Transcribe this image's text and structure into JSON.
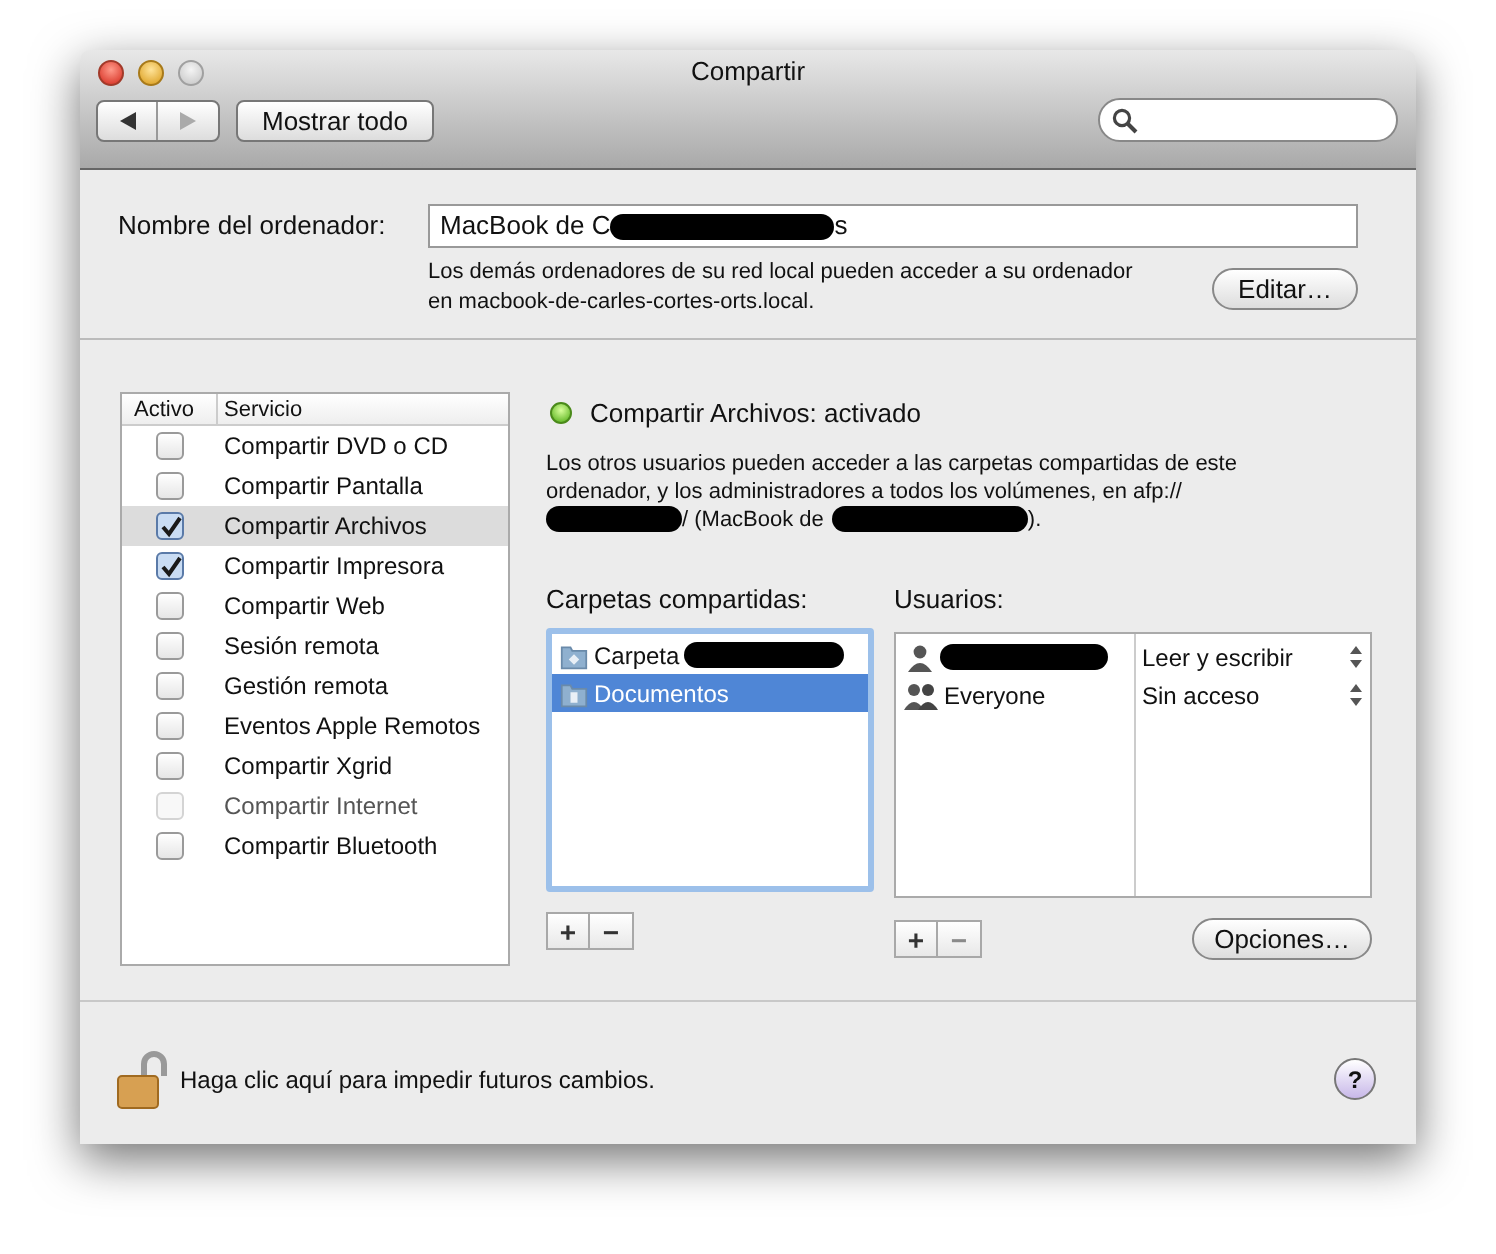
{
  "window": {
    "title": "Compartir"
  },
  "toolbar": {
    "show_all": "Mostrar todo",
    "search": {
      "kind": "round"
    }
  },
  "computer_name": {
    "label": "Nombre del ordenador:",
    "value": "MacBook de C",
    "value_tail": "s",
    "note": "Los demás ordenadores de su red local pueden acceder a su ordenador en macbook-de-carles-cortes-orts.local.",
    "edit_button": "Editar…"
  },
  "services": {
    "columns": [
      "Activo",
      "Servicio"
    ],
    "items": [
      {
        "name": "Compartir DVD o CD",
        "checked": false,
        "disabled": false,
        "selected": false
      },
      {
        "name": "Compartir Pantalla",
        "checked": false,
        "disabled": false,
        "selected": false
      },
      {
        "name": "Compartir Archivos",
        "checked": true,
        "disabled": false,
        "selected": true
      },
      {
        "name": "Compartir Impresora",
        "checked": true,
        "disabled": false,
        "selected": false
      },
      {
        "name": "Compartir Web",
        "checked": false,
        "disabled": false,
        "selected": false
      },
      {
        "name": "Sesión remota",
        "checked": false,
        "disabled": false,
        "selected": false
      },
      {
        "name": "Gestión remota",
        "checked": false,
        "disabled": false,
        "selected": false
      },
      {
        "name": "Eventos Apple Remotos",
        "checked": false,
        "disabled": false,
        "selected": false
      },
      {
        "name": "Compartir Xgrid",
        "checked": false,
        "disabled": false,
        "selected": false
      },
      {
        "name": "Compartir Internet",
        "checked": false,
        "disabled": true,
        "selected": false
      },
      {
        "name": "Compartir Bluetooth",
        "checked": false,
        "disabled": false,
        "selected": false
      }
    ]
  },
  "status": {
    "text": "Compartir Archivos: activado",
    "on": true,
    "description": "Los otros usuarios pueden acceder a las carpetas compartidas de este ordenador, y los administradores a todos los volúmenes, en afp://",
    "address_tail": "/ (MacBook de",
    "address_end": ")."
  },
  "folders": {
    "label": "Carpetas compartidas:",
    "items": [
      {
        "name": "Carpeta",
        "kind": "public",
        "selected": false
      },
      {
        "name": "Documentos",
        "kind": "documents",
        "selected": true
      }
    ],
    "add": "+",
    "remove": "−",
    "remove_disabled": false
  },
  "users": {
    "label": "Usuarios:",
    "items": [
      {
        "kind": "user",
        "permission": "Leer y escribir"
      },
      {
        "name": "Everyone",
        "kind": "group",
        "permission": "Sin acceso"
      }
    ],
    "add": "+",
    "remove": "−",
    "remove_disabled": true
  },
  "options_button": "Opciones…",
  "footer": {
    "lock_text": "Haga clic aquí para impedir futuros cambios.",
    "locked": false,
    "help": "?"
  }
}
